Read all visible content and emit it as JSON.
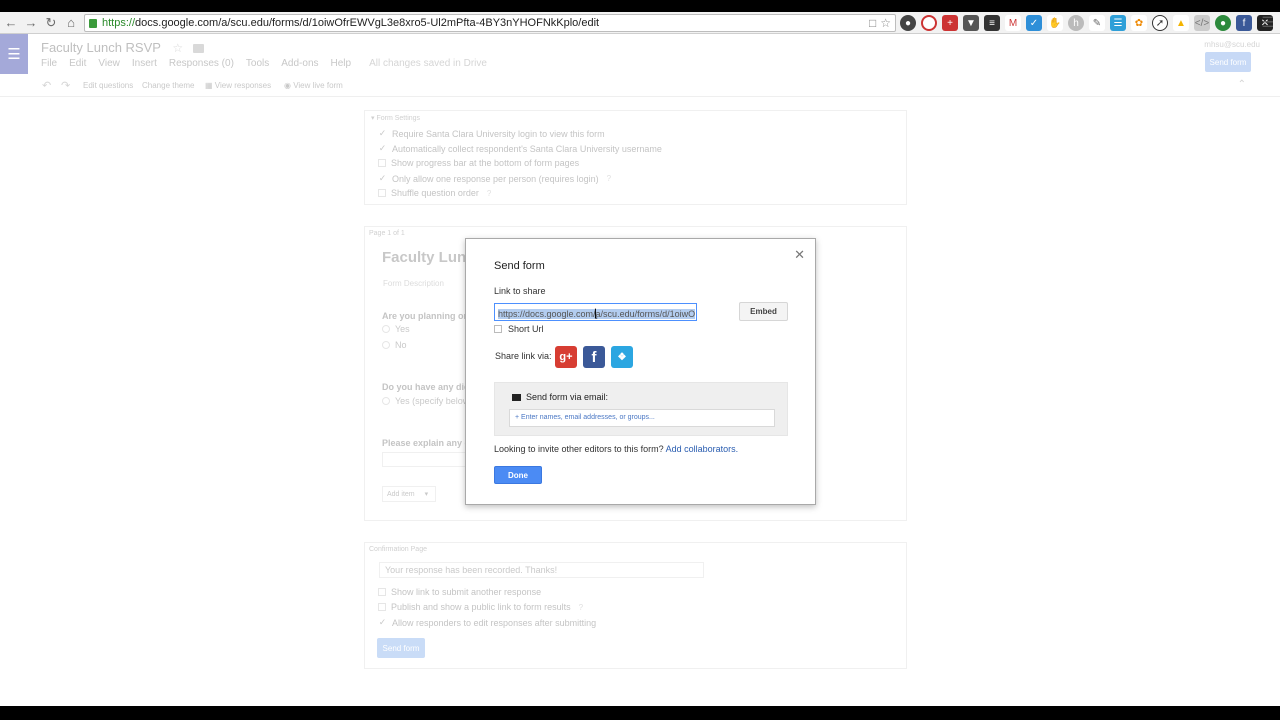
{
  "browser": {
    "url_scheme": "https://",
    "url_rest": "docs.google.com/a/scu.edu/forms/d/1oiwOfrEWVgL3e8xro5-Ul2mPfta-4BY3nYHOFNkKplo/edit",
    "back_icon": "back-arrow-icon",
    "forward_icon": "forward-arrow-icon",
    "reload_icon": "reload-icon",
    "home_icon": "home-icon"
  },
  "app": {
    "title": "Faculty Lunch RSVP",
    "account": "mhsu@scu.edu",
    "send_form_top": "Send form",
    "menu": [
      "File",
      "Edit",
      "View",
      "Insert",
      "Responses (0)",
      "Tools",
      "Add-ons",
      "Help"
    ],
    "saved_status": "All changes saved in Drive"
  },
  "toolbar": {
    "edit_questions": "Edit questions",
    "change_theme": "Change theme",
    "view_responses": "View responses",
    "view_live_form": "View live form"
  },
  "settings": {
    "header": "Form Settings",
    "options": [
      {
        "label": "Require Santa Clara University login to view this form",
        "checked": true
      },
      {
        "label": "Automatically collect respondent's Santa Clara University username",
        "checked": true
      },
      {
        "label": "Show progress bar at the bottom of form pages",
        "checked": false
      },
      {
        "label": "Only allow one response per person (requires login)",
        "checked": true
      },
      {
        "label": "Shuffle question order",
        "checked": false
      }
    ]
  },
  "form": {
    "page_label": "Page 1 of 1",
    "title": "Faculty Lunch",
    "description": "Form Description",
    "q1": "Are you planning on",
    "q1_options": [
      "Yes",
      "No"
    ],
    "q2": "Do you have any die",
    "q2_option": "Yes (specify below",
    "q3": "Please explain any d",
    "add_item": "Add item"
  },
  "confirmation": {
    "header": "Confirmation Page",
    "message": "Your response has been recorded. Thanks!",
    "options": [
      {
        "label": "Show link to submit another response",
        "checked": false
      },
      {
        "label": "Publish and show a public link to form results",
        "checked": false
      },
      {
        "label": "Allow responders to edit responses after submitting",
        "checked": true
      }
    ],
    "send_form": "Send form"
  },
  "dialog": {
    "title": "Send form",
    "link_label": "Link to share",
    "link_value": "https://docs.google.com/a/scu.edu/forms/d/1oiwO",
    "embed": "Embed",
    "short_url": "Short Url",
    "share_via": "Share link via:",
    "email_title": "Send form via email:",
    "email_placeholder": "+ Enter names, email addresses, or groups...",
    "invite_text": "Looking to invite other editors to this form?",
    "add_collaborators": "Add collaborators.",
    "done": "Done",
    "close_icon": "close-icon"
  },
  "colors": {
    "done_button": "#4b8bf4",
    "google_plus": "#d73d32",
    "facebook": "#3b5998",
    "twitter": "#2ba6e1",
    "link_color": "#2a5db0"
  }
}
